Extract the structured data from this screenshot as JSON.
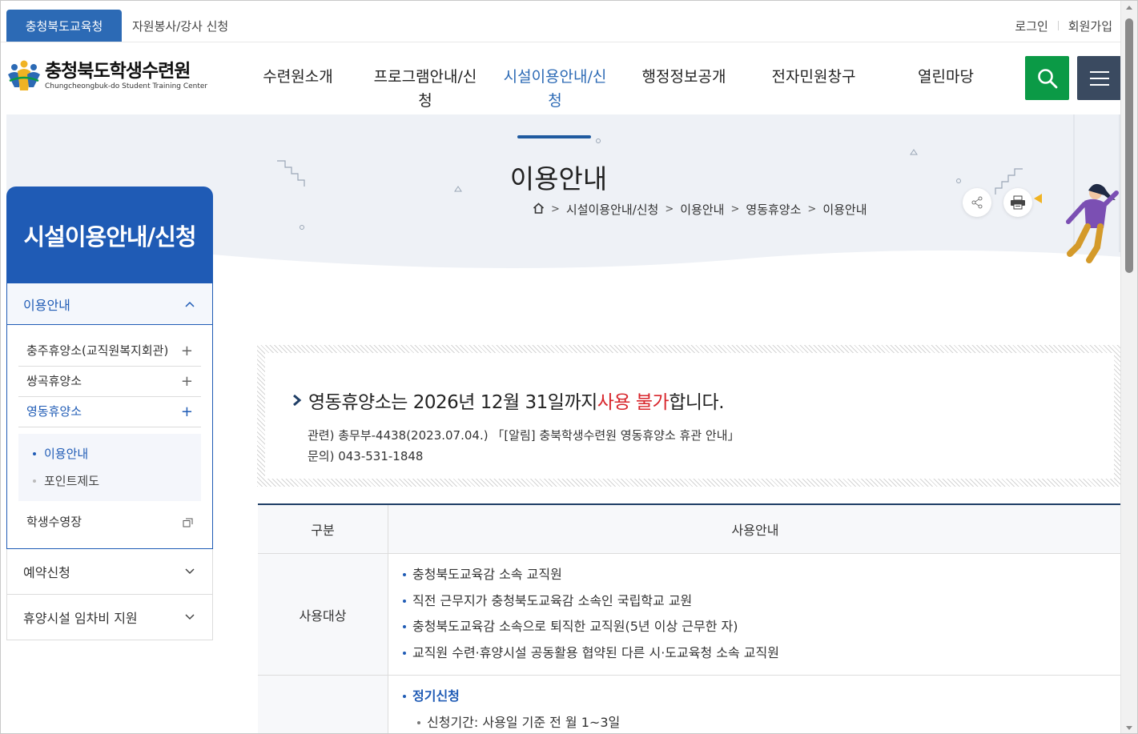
{
  "topbar": {
    "tab_edu": "충청북도교육청",
    "tab_volunteer": "자원봉사/강사 신청",
    "login": "로그인",
    "join": "회원가입"
  },
  "logo": {
    "name_ko": "충청북도학생수련원",
    "name_en": "Chungcheongbuk-do Student Training Center"
  },
  "gnb": {
    "items": [
      {
        "label": "수련원소개"
      },
      {
        "label": "프로그램안내/신청"
      },
      {
        "label": "시설이용안내/신청",
        "active": true
      },
      {
        "label": "행정정보공개"
      },
      {
        "label": "전자민원창구"
      },
      {
        "label": "열린마당"
      }
    ]
  },
  "icons": {
    "search": "search-icon",
    "menu": "hamburger-menu-icon",
    "home": "home-icon",
    "share": "share-icon",
    "print": "print-icon"
  },
  "visual": {
    "title": "이용안내",
    "breadcrumb": [
      "시설이용안내/신청",
      "이용안내",
      "영동휴양소",
      "이용안내"
    ]
  },
  "lnb": {
    "title": "시설이용안내/신청",
    "active_section": "이용안내",
    "sub_items": [
      {
        "label": "충주휴양소(교직원복지회관)",
        "toggle": "+"
      },
      {
        "label": "쌍곡휴양소",
        "toggle": "+"
      },
      {
        "label": "영동휴양소",
        "toggle": "+",
        "active": true
      },
      {
        "label": "학생수영장",
        "toggle": "external"
      }
    ],
    "third_items": [
      {
        "label": "이용안내",
        "active": true
      },
      {
        "label": "포인트제도"
      }
    ],
    "other_sections": [
      "예약신청",
      "휴양시설 임차비 지원"
    ]
  },
  "notice": {
    "prefix": "영동휴양소는 2026년 12월 31일까지 ",
    "highlight": "사용 불가",
    "suffix": "합니다.",
    "related": "관련) 총무부-4438(2023.07.04.) 「[알림] 충북학생수련원 영동휴양소 휴관 안내」",
    "contact": "문의) 043-531-1848"
  },
  "table": {
    "headers": [
      "구분",
      "사용안내"
    ],
    "rows": [
      {
        "category": "사용대상",
        "items": [
          "충청북도교육감 소속 교직원",
          "직전 근무지가 충청북도교육감 소속인 국립학교 교원",
          "충청북도교육감 소속으로 퇴직한 교직원(5년 이상 근무한 자)",
          "교직원 수련·휴양시설 공동활용 협약된 다른 시·도교육청 소속 교직원"
        ]
      }
    ],
    "partial_row": {
      "heading": "정기신청",
      "sub_item": "신청기간: 사용일 기준 전 월 1~3일"
    }
  },
  "colors": {
    "primary_blue": "#1f5bb5",
    "tab_blue": "#2c6ab5",
    "search_green": "#0b9a46",
    "menu_navy": "#3a4a60",
    "alert_red": "#d8262c"
  }
}
